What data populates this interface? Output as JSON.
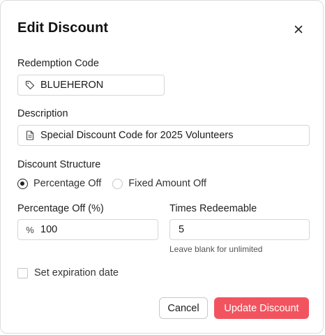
{
  "dialog": {
    "title": "Edit Discount",
    "close_icon": "close-icon"
  },
  "redemption_code": {
    "label": "Redemption Code",
    "icon": "tag-icon",
    "value": "BLUEHERON"
  },
  "description": {
    "label": "Description",
    "icon": "document-icon",
    "value": "Special Discount Code for 2025 Volunteers"
  },
  "discount_structure": {
    "label": "Discount Structure",
    "options": [
      {
        "label": "Percentage Off",
        "selected": true
      },
      {
        "label": "Fixed Amount Off",
        "selected": false
      }
    ]
  },
  "percentage_off": {
    "label": "Percentage Off (%)",
    "prefix": "%",
    "value": "100"
  },
  "times_redeemable": {
    "label": "Times Redeemable",
    "value": "5",
    "hint": "Leave blank for unlimited"
  },
  "expiration": {
    "label": "Set expiration date",
    "checked": false
  },
  "actions": {
    "cancel_label": "Cancel",
    "update_label": "Update Discount"
  },
  "colors": {
    "primary": "#f2545f",
    "border": "#d6d6d6"
  }
}
